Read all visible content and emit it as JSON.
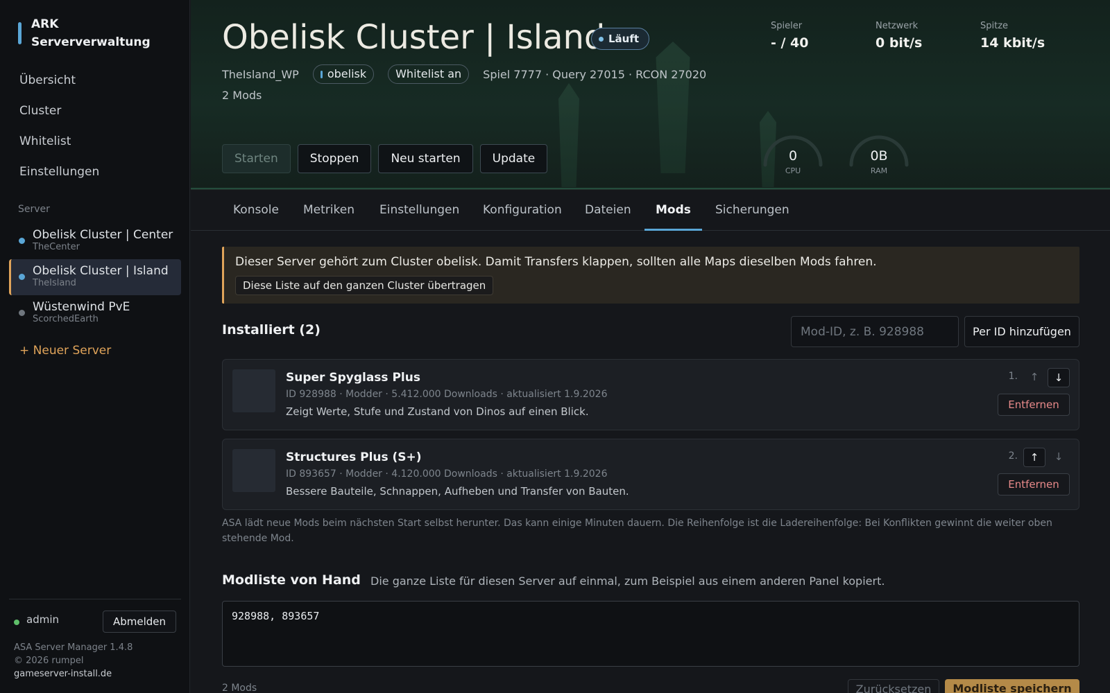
{
  "sidebar": {
    "brand": {
      "line1": "ARK",
      "line2": "Serververwaltung"
    },
    "nav": [
      {
        "label": "Übersicht"
      },
      {
        "label": "Cluster"
      },
      {
        "label": "Whitelist"
      },
      {
        "label": "Einstellungen"
      }
    ],
    "section_label": "Server",
    "servers": [
      {
        "name": "Obelisk Cluster | Center",
        "map": "TheCenter",
        "status_color": "#5aa6d6",
        "active": false
      },
      {
        "name": "Obelisk Cluster | Island",
        "map": "TheIsland",
        "status_color": "#5aa6d6",
        "active": true
      },
      {
        "name": "Wüstenwind PvE",
        "map": "ScorchedEarth",
        "status_color": "#6f767e",
        "active": false
      }
    ],
    "new_server": "+ Neuer Server",
    "user": {
      "name": "admin",
      "status_color": "#5fbf6a"
    },
    "logout": "Abmelden",
    "footer": {
      "version": "ASA Server Manager 1.4.8",
      "copyright": "© 2026 rumpel",
      "link": "gameserver-install.de"
    }
  },
  "hero": {
    "title": "Obelisk Cluster | Island",
    "status": "Läuft",
    "map_id": "TheIsland_WP",
    "cluster": "obelisk",
    "whitelist": "Whitelist an",
    "ports": "Spiel 7777 · Query 27015 · RCON 27020",
    "mods_count": "2 Mods",
    "stats": [
      {
        "label": "Spieler",
        "value": "- / 40"
      },
      {
        "label": "Netzwerk",
        "value": "0 bit/s"
      },
      {
        "label": "Spitze",
        "value": "14 kbit/s"
      }
    ],
    "actions": {
      "start": "Starten",
      "stop": "Stoppen",
      "restart": "Neu starten",
      "update": "Update"
    },
    "gauges": {
      "cpu": {
        "value": "0",
        "label": "CPU"
      },
      "ram": {
        "value": "0B",
        "label": "RAM"
      }
    },
    "accent_color": "#e0a45a"
  },
  "tabs": [
    {
      "label": "Konsole",
      "active": false
    },
    {
      "label": "Metriken",
      "active": false
    },
    {
      "label": "Einstellungen",
      "active": false
    },
    {
      "label": "Konfiguration",
      "active": false
    },
    {
      "label": "Dateien",
      "active": false
    },
    {
      "label": "Mods",
      "active": true
    },
    {
      "label": "Sicherungen",
      "active": false
    }
  ],
  "notice": {
    "text": "Dieser Server gehört zum Cluster obelisk. Damit Transfers klappen, sollten alle Maps dieselben Mods fahren.",
    "button": "Diese Liste auf den ganzen Cluster übertragen"
  },
  "installed": {
    "title": "Installiert (2)",
    "input_placeholder": "Mod-ID, z. B. 928988",
    "add_button": "Per ID hinzufügen",
    "mods": [
      {
        "position": "1.",
        "name": "Super Spyglass Plus",
        "meta": "ID 928988 · Modder · 5.412.000 Downloads · aktualisiert 1.9.2026",
        "description": "Zeigt Werte, Stufe und Zustand von Dinos auf einen Blick.",
        "up_enabled": false,
        "down_enabled": true,
        "remove": "Entfernen"
      },
      {
        "position": "2.",
        "name": "Structures Plus (S+)",
        "meta": "ID 893657 · Modder · 4.120.000 Downloads · aktualisiert 1.9.2026",
        "description": "Bessere Bauteile, Schnappen, Aufheben und Transfer von Bauten.",
        "up_enabled": true,
        "down_enabled": false,
        "remove": "Entfernen"
      }
    ],
    "hint": "ASA lädt neue Mods beim nächsten Start selbst herunter. Das kann einige Minuten dauern. Die Reihenfolge ist die Ladereihenfolge: Bei Konflikten gewinnt die weiter oben stehende Mod."
  },
  "manual": {
    "title": "Modliste von Hand",
    "subtitle": "Die ganze Liste für diesen Server auf einmal, zum Beispiel aus einem anderen Panel kopiert.",
    "value": "928988, 893657",
    "count": "2 Mods",
    "reset": "Zurücksetzen",
    "save": "Modliste speichern"
  },
  "icons": {
    "arrow_up": "arrow-up-icon",
    "arrow_down": "arrow-down-icon"
  }
}
